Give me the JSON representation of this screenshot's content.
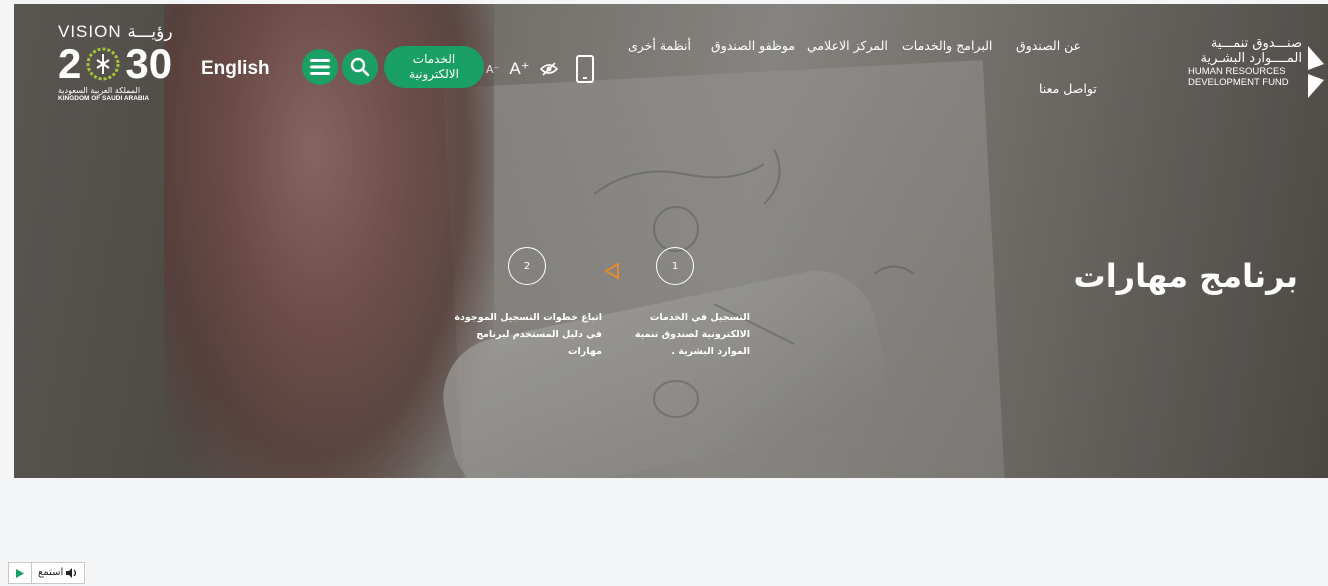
{
  "header": {
    "vision": {
      "top_text": "VISION رؤيـــة",
      "year_left": "2",
      "year_right": "30",
      "arabic": "المملكة العربية السعودية",
      "english": "KINGDOM OF SAUDI ARABIA"
    },
    "language_link": "English",
    "eservices_line1": "الخدمات",
    "eservices_line2": "الالكترونية",
    "font_decrease": "A⁻",
    "font_increase": "A⁺",
    "nav": [
      {
        "label": "أنظمة أخرى"
      },
      {
        "label": "موظفو الصندوق"
      },
      {
        "label": "المركز الاعلامي"
      },
      {
        "label": "البرامج والخدمات"
      },
      {
        "label": "عن الصندوق"
      },
      {
        "label": "تواصل معنا"
      }
    ],
    "logo": {
      "arabic_line1": "صنـــدوق تنمـــية",
      "arabic_line2": "المــــوارد البشـرية",
      "english_line1": "HUMAN RESOURCES",
      "english_line2": "DEVELOPMENT FUND"
    }
  },
  "hero": {
    "title": "برنامج مهارات",
    "steps": [
      {
        "number": "1",
        "text": "التسجيل في الخدمات الالكترونية لصندوق تنمية الموارد البشرية ."
      },
      {
        "number": "2",
        "text": "اتباع خطوات التسجيل الموجودة في دليل المستخدم لبرنامج مهارات"
      }
    ]
  },
  "listen": {
    "label": "استمع"
  },
  "colors": {
    "accent_green": "#1aa065",
    "step_arrow": "#f08a24",
    "page_bg": "#f4f5f6"
  },
  "icons": [
    "hamburger-icon",
    "search-icon",
    "eye-slash-icon",
    "mobile-phone-icon",
    "play-icon",
    "speaker-icon"
  ]
}
